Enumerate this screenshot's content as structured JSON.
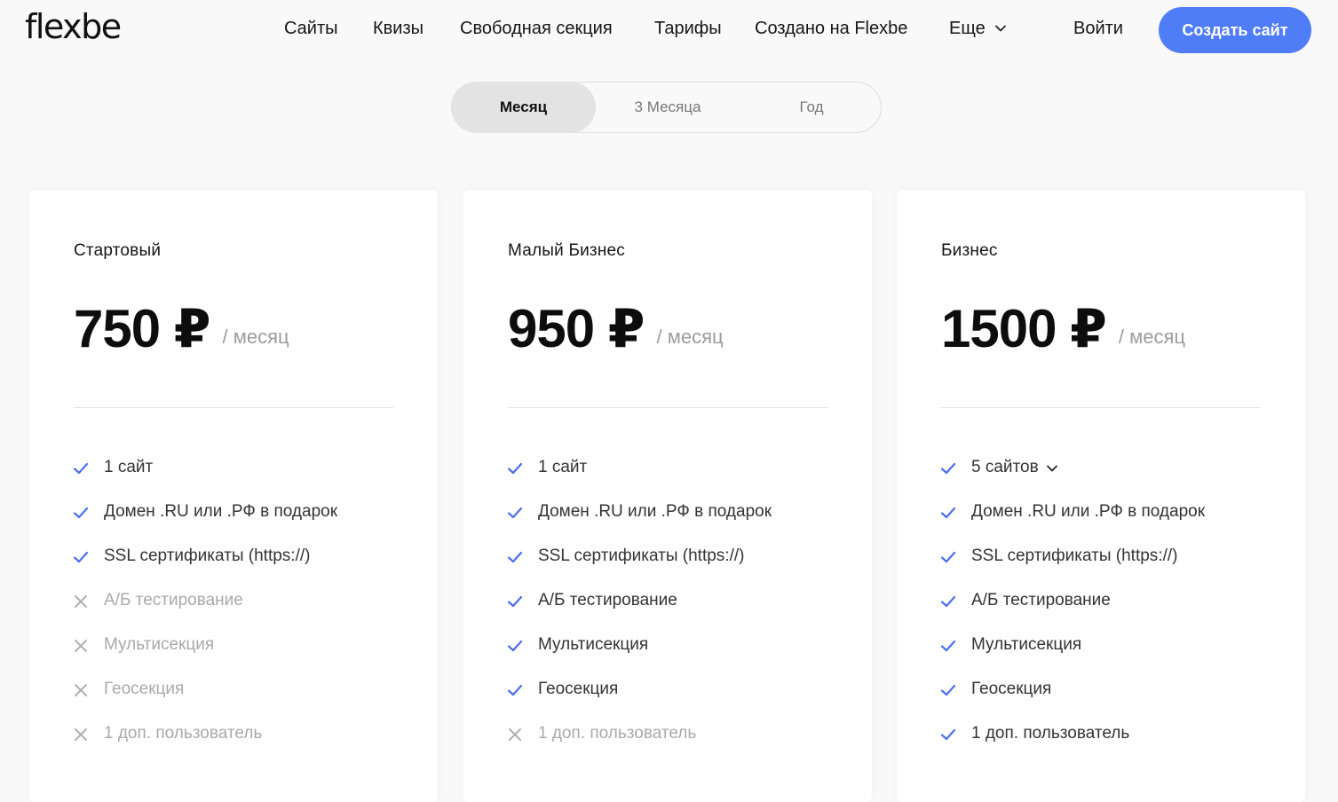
{
  "header": {
    "logo": "flexbe",
    "nav": [
      {
        "label": "Сайты"
      },
      {
        "label": "Квизы"
      },
      {
        "label": "Свободная секция"
      },
      {
        "label": "Тарифы"
      },
      {
        "label": "Создано на Flexbe"
      },
      {
        "label": "Еще"
      }
    ],
    "login_label": "Войти",
    "cta_label": "Создать сайт"
  },
  "colors": {
    "accent": "#4f7cf7",
    "check": "#4a6ff0",
    "cross": "#b0b0b0"
  },
  "period_tabs": [
    {
      "label": "Месяц",
      "active": true
    },
    {
      "label": "3 Месяца",
      "active": false
    },
    {
      "label": "Год",
      "active": false
    }
  ],
  "plans": [
    {
      "title": "Стартовый",
      "price": "750 ₽",
      "period": "/ месяц",
      "features": [
        {
          "text": "1 сайт",
          "included": true
        },
        {
          "text": "Домен .RU или .РФ в подарок",
          "included": true
        },
        {
          "text": "SSL сертификаты (https://)",
          "included": true
        },
        {
          "text": "А/Б тестирование",
          "included": false
        },
        {
          "text": "Мультисекция",
          "included": false
        },
        {
          "text": "Геосекция",
          "included": false
        },
        {
          "text": "1 доп. пользователь",
          "included": false
        }
      ]
    },
    {
      "title": "Малый Бизнес",
      "price": "950 ₽",
      "period": "/ месяц",
      "features": [
        {
          "text": "1 сайт",
          "included": true
        },
        {
          "text": "Домен .RU или .РФ в подарок",
          "included": true
        },
        {
          "text": "SSL сертификаты (https://)",
          "included": true
        },
        {
          "text": "А/Б тестирование",
          "included": true
        },
        {
          "text": "Мультисекция",
          "included": true
        },
        {
          "text": "Геосекция",
          "included": true
        },
        {
          "text": "1 доп. пользователь",
          "included": false
        }
      ]
    },
    {
      "title": "Бизнес",
      "price": "1500 ₽",
      "period": "/ месяц",
      "features": [
        {
          "text": "5 сайтов",
          "included": true
        },
        {
          "text": "Домен .RU или .РФ в подарок",
          "included": true
        },
        {
          "text": "SSL сертификаты (https://)",
          "included": true
        },
        {
          "text": "А/Б тестирование",
          "included": true
        },
        {
          "text": "Мультисекция",
          "included": true
        },
        {
          "text": "Геосекция",
          "included": true
        },
        {
          "text": "1 доп. пользователь",
          "included": true
        }
      ]
    }
  ]
}
